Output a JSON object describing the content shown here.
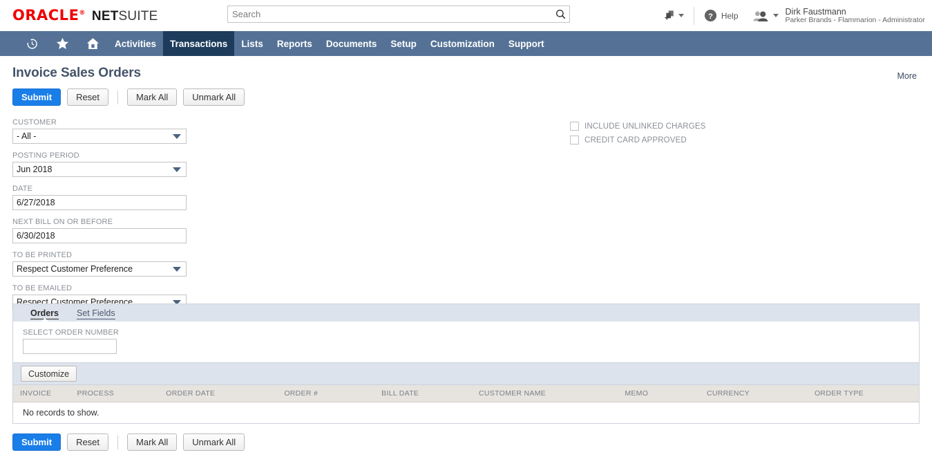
{
  "brand": {
    "oracle": "ORACLE",
    "net": "NET",
    "suite": "SUITE",
    "accent_red": "#f00000"
  },
  "search": {
    "placeholder": "Search",
    "value": ""
  },
  "topbar": {
    "help_label": "Help",
    "user_name": "Dirk Faustmann",
    "user_role": "Parker Brands - Flammarion - Administrator"
  },
  "nav": {
    "icons": [
      "history-icon",
      "star-icon",
      "home-icon"
    ],
    "items": [
      {
        "label": "Activities",
        "active": false
      },
      {
        "label": "Transactions",
        "active": true
      },
      {
        "label": "Lists",
        "active": false
      },
      {
        "label": "Reports",
        "active": false
      },
      {
        "label": "Documents",
        "active": false
      },
      {
        "label": "Setup",
        "active": false
      },
      {
        "label": "Customization",
        "active": false
      },
      {
        "label": "Support",
        "active": false
      }
    ]
  },
  "page": {
    "title": "Invoice Sales Orders",
    "more_label": "More"
  },
  "toolbar": {
    "submit_label": "Submit",
    "reset_label": "Reset",
    "mark_all_label": "Mark All",
    "unmark_all_label": "Unmark All"
  },
  "form": {
    "fields": [
      {
        "label": "CUSTOMER",
        "value": "- All -",
        "type": "select"
      },
      {
        "label": "POSTING PERIOD",
        "value": "Jun 2018",
        "type": "select"
      },
      {
        "label": "DATE",
        "value": "6/27/2018",
        "type": "text"
      },
      {
        "label": "NEXT BILL ON OR BEFORE",
        "value": "6/30/2018",
        "type": "text"
      },
      {
        "label": "TO BE PRINTED",
        "value": "Respect Customer Preference",
        "type": "select"
      },
      {
        "label": "TO BE EMAILED",
        "value": "Respect Customer Preference",
        "type": "select"
      }
    ],
    "checkboxes": [
      {
        "label": "INCLUDE UNLINKED CHARGES",
        "checked": false
      },
      {
        "label": "CREDIT CARD APPROVED",
        "checked": false
      }
    ]
  },
  "panel": {
    "tabs": [
      {
        "label": "Orders",
        "active": true
      },
      {
        "label": "Set Fields",
        "active": false
      }
    ],
    "select_order_label": "SELECT ORDER NUMBER",
    "select_order_value": "",
    "customize_label": "Customize",
    "columns": [
      "INVOICE",
      "PROCESS",
      "ORDER DATE",
      "ORDER #",
      "BILL DATE",
      "CUSTOMER NAME",
      "MEMO",
      "CURRENCY",
      "ORDER TYPE"
    ],
    "rows": [],
    "empty_message": "No records to show."
  },
  "colors": {
    "nav_bg": "#557296",
    "nav_active_bg": "#1d3c5c",
    "primary_button": "#1a7ee8",
    "panel_header": "#dde3ec",
    "table_header": "#e7e4df"
  }
}
